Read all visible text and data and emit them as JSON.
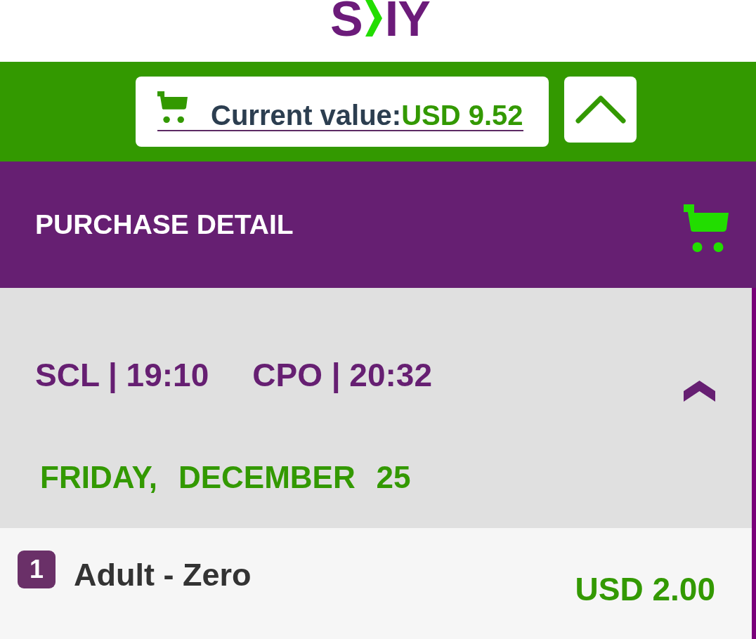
{
  "logo": {
    "lead": "S",
    "tail": "IY"
  },
  "cart": {
    "label": "Current value:",
    "amount": "USD 9.52",
    "expanded": true
  },
  "purchase_detail": {
    "title": "PURCHASE DETAIL"
  },
  "trips": [
    {
      "origin": "SCL | 19:10",
      "destination": "CPO | 20:32",
      "date": "FRIDAY, DECEMBER 25",
      "expanded": true,
      "passengers": [
        {
          "count": "1",
          "type": "Adult - Zero",
          "price": "USD 2.00"
        }
      ]
    }
  ]
}
